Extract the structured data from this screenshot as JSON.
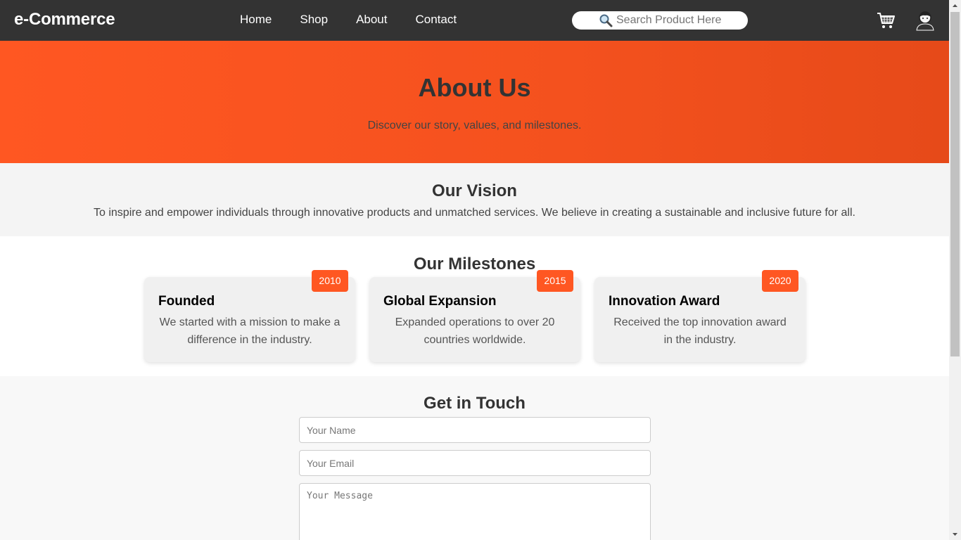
{
  "navbar": {
    "brand": "e-Commerce",
    "links": [
      "Home",
      "Shop",
      "About",
      "Contact"
    ],
    "search_placeholder": "Search Product Here",
    "icons": [
      "search-icon",
      "cart-icon",
      "user-icon"
    ]
  },
  "hero": {
    "title": "About Us",
    "subtitle": "Discover our story, values, and milestones."
  },
  "vision": {
    "title": "Our Vision",
    "text": "To inspire and empower individuals through innovative products and unmatched services. We believe in creating a sustainable and inclusive future for all."
  },
  "milestones": {
    "title": "Our Milestones",
    "items": [
      {
        "year": "2010",
        "title": "Founded",
        "text": "We started with a mission to make a difference in the industry."
      },
      {
        "year": "2015",
        "title": "Global Expansion",
        "text": "Expanded operations to over 20 countries worldwide."
      },
      {
        "year": "2020",
        "title": "Innovation Award",
        "text": "Received the top innovation award in the industry."
      }
    ]
  },
  "contact": {
    "title": "Get in Touch",
    "name_placeholder": "Your Name",
    "email_placeholder": "Your Email",
    "message_placeholder": "Your Message"
  },
  "colors": {
    "accent": "#ff5722",
    "navbar": "#333333"
  }
}
